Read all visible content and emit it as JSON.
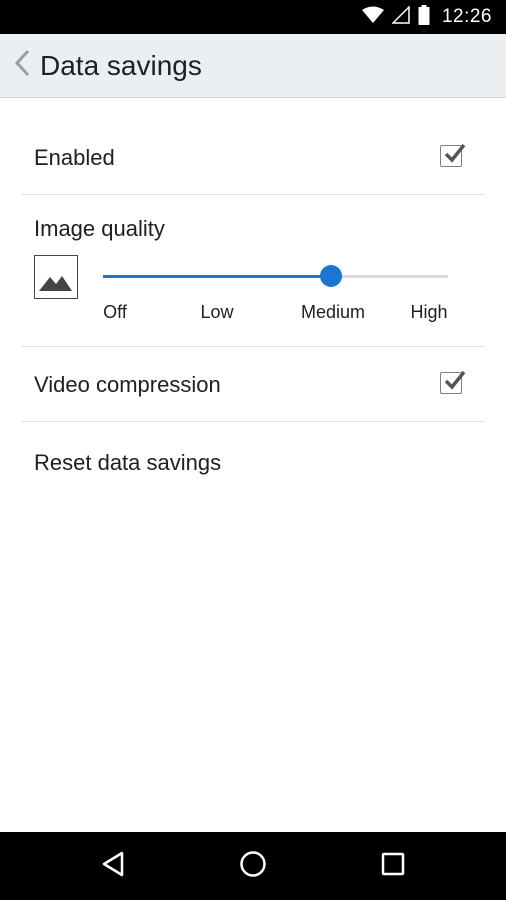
{
  "status_bar": {
    "time": "12:26",
    "icons": [
      "wifi-icon",
      "signal-icon",
      "battery-icon"
    ]
  },
  "app_bar": {
    "back_icon": "chevron-left-icon",
    "title": "Data savings"
  },
  "settings": {
    "enabled": {
      "label": "Enabled",
      "checked": true
    },
    "image_quality": {
      "label": "Image quality",
      "icon": "image-icon",
      "levels": [
        "Off",
        "Low",
        "Medium",
        "High"
      ],
      "selected": "Medium"
    },
    "video_compression": {
      "label": "Video compression",
      "checked": true
    },
    "reset": {
      "label": "Reset data savings"
    }
  },
  "nav_bar": {
    "icons": [
      "back-triangle-icon",
      "home-circle-icon",
      "recents-square-icon"
    ]
  },
  "colors": {
    "accent": "#1976d2",
    "app_bar_bg": "#eceff1",
    "checkbox_check": "#555555"
  }
}
